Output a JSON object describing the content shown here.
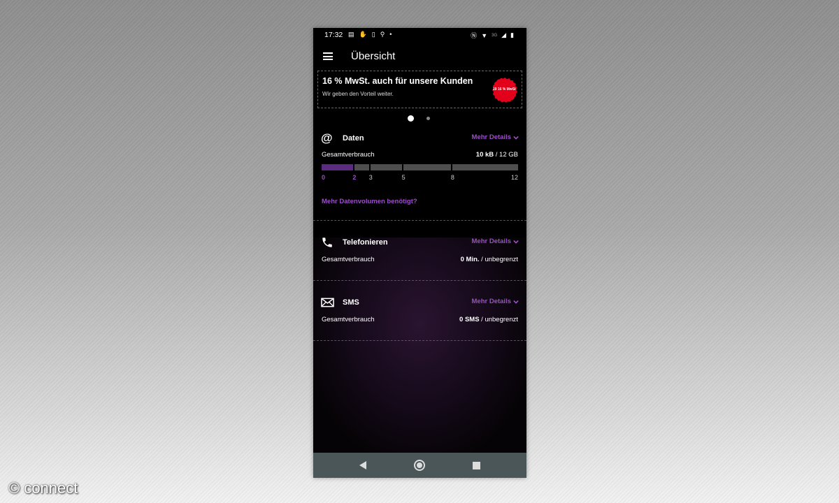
{
  "status_bar": {
    "time": "17:32",
    "network": "3G",
    "icons_left": [
      "message-icon",
      "hand-icon",
      "phone-icon",
      "keyhole-icon",
      "dot-icon"
    ],
    "icons_right": [
      "nfc-icon",
      "wifi-icon",
      "signal-icon",
      "battery-icon"
    ]
  },
  "app_bar": {
    "title": "Übersicht",
    "menu_icon": "hamburger-icon"
  },
  "banner": {
    "title": "16 % MwSt. auch für unsere Kunden",
    "subtitle": "Wir geben den Vorteil weiter.",
    "sticker_text": "19 16 % MwSt."
  },
  "carousel": {
    "count": 2,
    "active_index": 0
  },
  "daten": {
    "icon": "at-icon",
    "title": "Daten",
    "details_label": "Mehr Details",
    "usage_label": "Gesamtverbrauch",
    "usage_value": "10 kB",
    "usage_limit": "/ 12 GB",
    "scale": [
      "0",
      "2",
      "3",
      "5",
      "8",
      "12"
    ],
    "highlighted_ticks": [
      "0",
      "2"
    ],
    "used_up_to": 2,
    "more_volume_link": "Mehr Datenvolumen benötigt?"
  },
  "telefonieren": {
    "icon": "phone-icon",
    "title": "Telefonieren",
    "details_label": "Mehr Details",
    "usage_label": "Gesamtverbrauch",
    "usage_value": "0 Min.",
    "usage_limit": "/ unbegrenzt"
  },
  "sms": {
    "icon": "envelope-icon",
    "title": "SMS",
    "details_label": "Mehr Details",
    "usage_label": "Gesamtverbrauch",
    "usage_value": "0 SMS",
    "usage_limit": "/ unbegrenzt"
  },
  "nav_bar": {
    "buttons": [
      "back-icon",
      "home-icon",
      "recent-apps-icon"
    ]
  },
  "watermark": "© connect",
  "colors": {
    "accent": "#9b4fc7",
    "bar_used": "#5a2b7e",
    "bar_empty": "#4e4e4e",
    "navbar": "#4a5658",
    "sticker": "#e3001b"
  }
}
